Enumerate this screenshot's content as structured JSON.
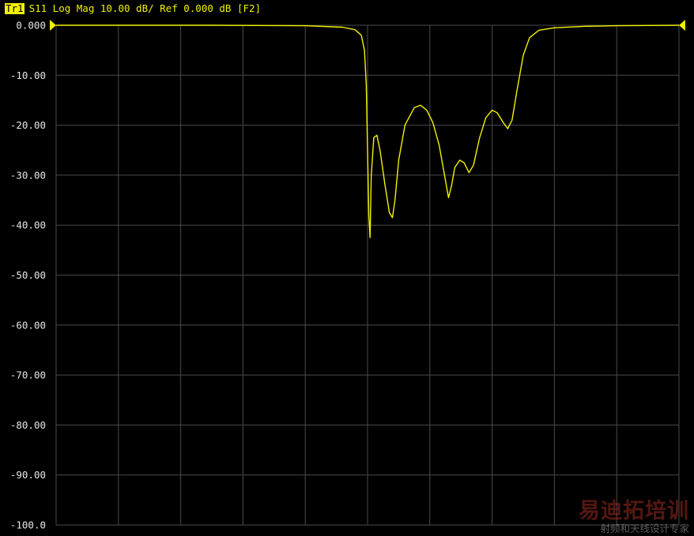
{
  "trace_header": {
    "badge": "Tr1",
    "text": "S11 Log Mag 10.00 dB/ Ref 0.000 dB [F2]"
  },
  "colors": {
    "background": "#000000",
    "grid": "#4a4a4a",
    "trace": "#f2f200",
    "tick_text": "#e6e6e6"
  },
  "watermark": {
    "title": "易迪拓培训",
    "subtitle": "射频和天线设计专家"
  },
  "chart_data": {
    "type": "line",
    "title": "S11 Log Mag 10.00 dB/ Ref 0.000 dB [F2]",
    "xlabel": "",
    "ylabel": "",
    "xlim": [
      0,
      10
    ],
    "ylim": [
      -100,
      0
    ],
    "grid": true,
    "x_divisions": 10,
    "y_divisions": 10,
    "reference_level": 0,
    "y_ticks": [
      "0.000",
      "-10.00",
      "-20.00",
      "-30.00",
      "-40.00",
      "-50.00",
      "-60.00",
      "-70.00",
      "-80.00",
      "-90.00",
      "-100.0"
    ],
    "series": [
      {
        "points": [
          [
            0.0,
            0.0
          ],
          [
            2.5,
            0.0
          ],
          [
            4.0,
            -0.1
          ],
          [
            4.6,
            -0.4
          ],
          [
            4.8,
            -0.9
          ],
          [
            4.9,
            -2.0
          ],
          [
            4.95,
            -5.0
          ],
          [
            4.98,
            -12.0
          ],
          [
            5.0,
            -25.0
          ],
          [
            5.02,
            -38.0
          ],
          [
            5.04,
            -42.5
          ],
          [
            5.06,
            -30.0
          ],
          [
            5.1,
            -22.5
          ],
          [
            5.15,
            -22.0
          ],
          [
            5.2,
            -25.0
          ],
          [
            5.28,
            -32.0
          ],
          [
            5.35,
            -37.5
          ],
          [
            5.4,
            -38.5
          ],
          [
            5.44,
            -35.0
          ],
          [
            5.5,
            -27.0
          ],
          [
            5.6,
            -20.0
          ],
          [
            5.75,
            -16.5
          ],
          [
            5.85,
            -16.0
          ],
          [
            5.95,
            -17.0
          ],
          [
            6.05,
            -19.5
          ],
          [
            6.15,
            -24.0
          ],
          [
            6.25,
            -31.0
          ],
          [
            6.3,
            -34.5
          ],
          [
            6.35,
            -32.0
          ],
          [
            6.4,
            -28.5
          ],
          [
            6.48,
            -27.0
          ],
          [
            6.55,
            -27.5
          ],
          [
            6.63,
            -29.5
          ],
          [
            6.7,
            -28.0
          ],
          [
            6.8,
            -22.5
          ],
          [
            6.9,
            -18.5
          ],
          [
            7.0,
            -17.0
          ],
          [
            7.08,
            -17.5
          ],
          [
            7.18,
            -19.5
          ],
          [
            7.25,
            -20.7
          ],
          [
            7.32,
            -19.0
          ],
          [
            7.4,
            -13.0
          ],
          [
            7.5,
            -6.0
          ],
          [
            7.6,
            -2.5
          ],
          [
            7.75,
            -1.0
          ],
          [
            8.0,
            -0.5
          ],
          [
            8.5,
            -0.2
          ],
          [
            9.0,
            -0.1
          ],
          [
            10.0,
            0.0
          ]
        ]
      }
    ]
  }
}
